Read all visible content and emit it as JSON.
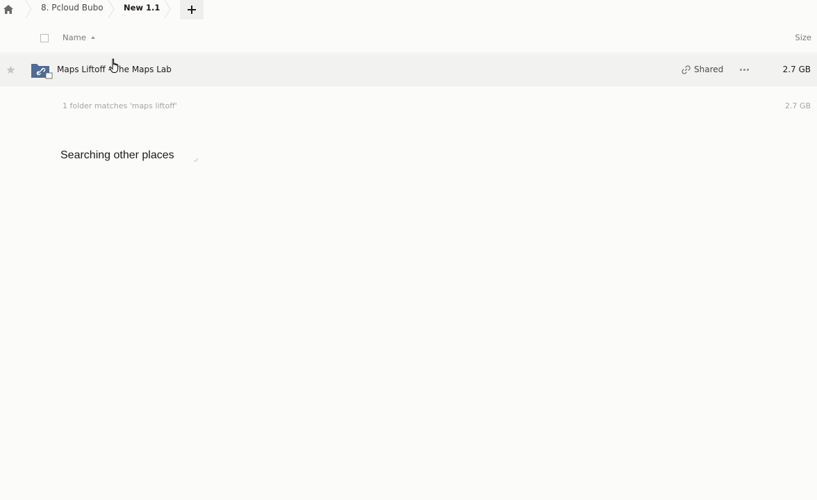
{
  "breadcrumb": {
    "home_icon": "home-icon",
    "items": [
      {
        "label": "8. Pcloud Bubo"
      },
      {
        "label": "New 1.1"
      }
    ],
    "add_icon": "plus-icon"
  },
  "table_header": {
    "name_label": "Name",
    "size_label": "Size",
    "sort": "ascending"
  },
  "rows": [
    {
      "name": "Maps Liftoff - The Maps Lab",
      "shared_label": "Shared",
      "size": "2.7 GB",
      "icon": "shared-folder-icon",
      "starred": false
    }
  ],
  "summary": {
    "text": "1 folder matches 'maps liftoff'",
    "size": "2.7 GB"
  },
  "searching": {
    "text": "Searching other places"
  },
  "colors": {
    "background": "#fbfbfa",
    "folder_blue": "#4f6b96",
    "row_hover": "#f2f2f1"
  }
}
